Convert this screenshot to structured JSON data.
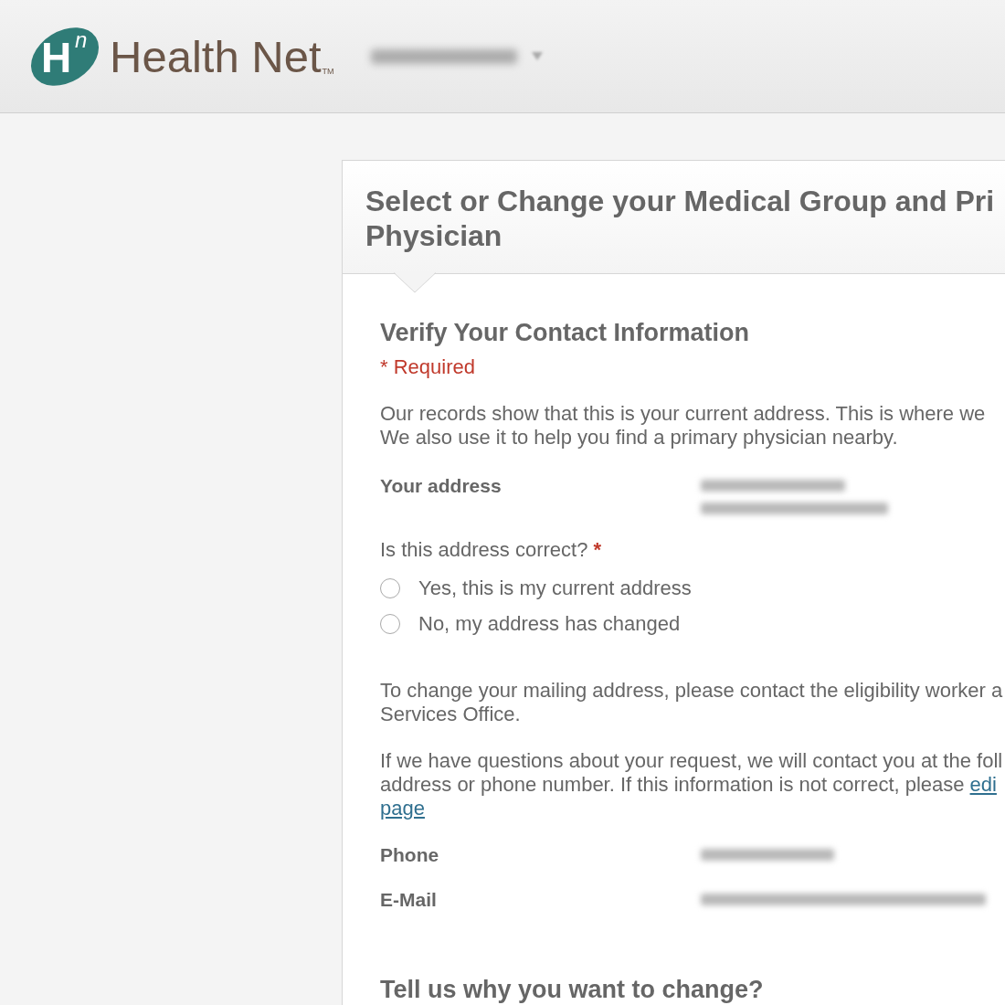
{
  "header": {
    "logo": {
      "letter": "H",
      "superscript": "n",
      "name": "Health Net",
      "trademark": "TM"
    }
  },
  "card": {
    "title_lines": [
      "Select or Change your Medical Group and Pri",
      "Physician"
    ],
    "section": {
      "heading": "Verify Your Contact Information",
      "required_note": "* Required",
      "intro_lines": [
        "Our records show that this is your current address. This is where we",
        "We also use it to help you find a primary physician nearby."
      ],
      "address": {
        "label": "Your address"
      },
      "question": {
        "label": "Is this address correct?",
        "required_mark": "*"
      },
      "options": [
        {
          "label": "Yes, this is my current address",
          "selected": false
        },
        {
          "label": "No, my address has changed",
          "selected": false
        }
      ],
      "change_note_lines": [
        "To change your mailing address, please contact the eligibility worker a",
        "Services Office."
      ],
      "contact_note_lines": [
        {
          "text": "If we have questions about your request, we will contact you at the foll"
        },
        {
          "text": "address or phone number. If this information is not correct, please",
          "link": "edi"
        },
        {
          "link": "page"
        }
      ],
      "contact_fields": [
        {
          "label": "Phone"
        },
        {
          "label": "E-Mail"
        }
      ]
    },
    "next_heading": "Tell us why you want to change?"
  }
}
